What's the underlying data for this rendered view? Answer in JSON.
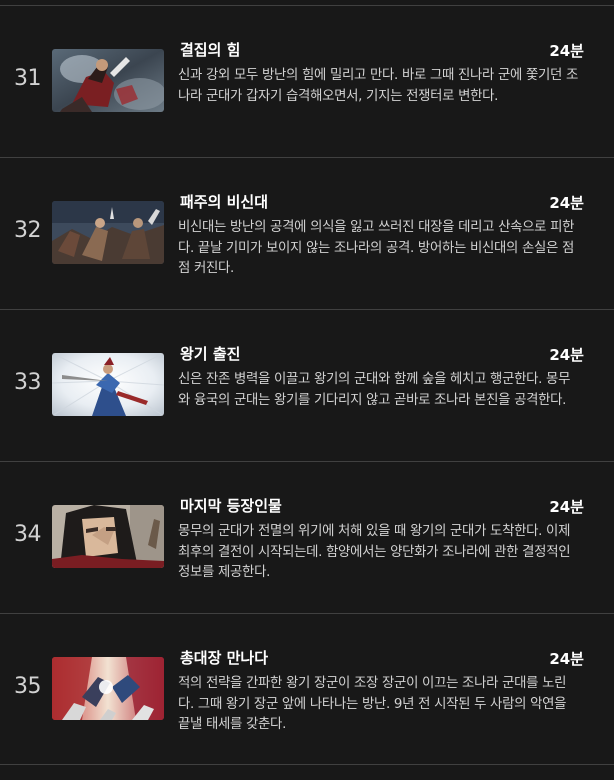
{
  "episodes": [
    {
      "number": "31",
      "title": "결집의 힘",
      "duration": "24분",
      "description": "신과 강외 모두 방난의 힘에 밀리고 만다. 바로 그때 진나라 군에 쫓기던 조나라 군대가 갑자기 습격해오면서, 기지는 전쟁터로 변한다.",
      "thumbnail_icon": "battle-scene-thumbnail"
    },
    {
      "number": "32",
      "title": "패주의 비신대",
      "duration": "24분",
      "description": "비신대는 방난의 공격에 의식을 잃고 쓰러진 대장을 데리고 산속으로 피한다. 끝날 기미가 보이지 않는 조나라의 공격. 방어하는 비신대의 손실은 점점 커진다.",
      "thumbnail_icon": "cavalry-thumbnail"
    },
    {
      "number": "33",
      "title": "왕기 출진",
      "duration": "24분",
      "description": "신은 잔존 병력을 이끌고 왕기의 군대와 함께 숲을 헤치고 행군한다. 몽무와 융국의 군대는 왕기를 기다리지 않고 곧바로 조나라 본진을 공격한다.",
      "thumbnail_icon": "warrior-light-thumbnail"
    },
    {
      "number": "34",
      "title": "마지막 등장인물",
      "duration": "24분",
      "description": "몽무의 군대가 전멸의 위기에 처해 있을 때 왕기의 군대가 도착한다. 이제 최후의 결전이 시작되는데. 함양에서는 양단화가 조나라에 관한 결정적인 정보를 제공한다.",
      "thumbnail_icon": "long-hair-man-thumbnail"
    },
    {
      "number": "35",
      "title": "총대장 만나다",
      "duration": "24분",
      "description": "적의 전략을 간파한 왕기 장군이 조장 장군이 이끄는 조나라 군대를 노린다. 그때 왕기 장군 앞에 나타나는 방난. 9년 전 시작된 두 사람의 악연을 끝낼 태세를 갖춘다.",
      "thumbnail_icon": "clash-thumbnail"
    }
  ]
}
